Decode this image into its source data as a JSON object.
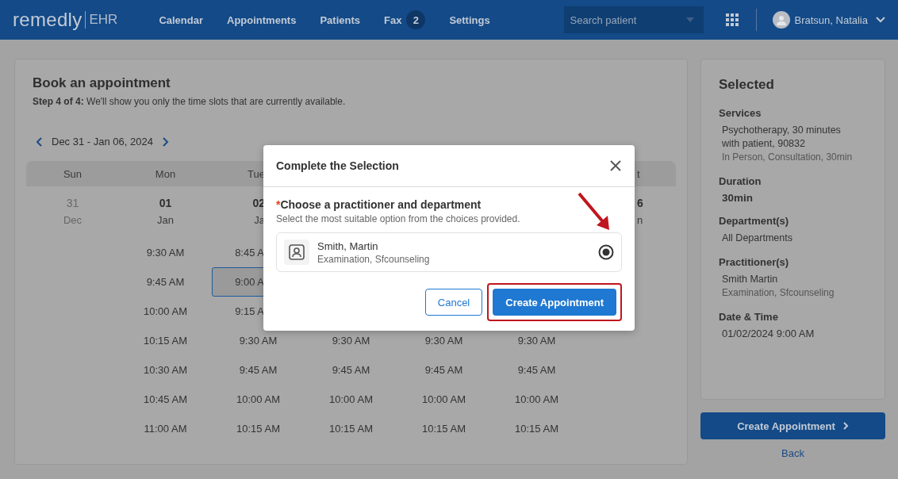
{
  "nav": {
    "logo": "remedly",
    "logo_suffix": "EHR",
    "items": [
      {
        "label": "Calendar"
      },
      {
        "label": "Appointments"
      },
      {
        "label": "Patients"
      },
      {
        "label": "Fax",
        "badge": "2"
      },
      {
        "label": "Settings"
      }
    ],
    "search": {
      "placeholder": "Search patient"
    },
    "user": "Bratsun, Natalia"
  },
  "booking": {
    "title": "Book an appointment",
    "step": "**Step 4 of 4:** We'll show you only the time slots that are currently available.",
    "range": "Dec 31 - Jan 06, 2024",
    "days": [
      {
        "kind": "whole",
        "day": "Sun",
        "date": "31",
        "month": "Dec",
        "muted": true
      },
      {
        "kind": "whole",
        "day": "Mon",
        "date": "01",
        "month": "Jan",
        "muted": false,
        "slots": [
          {
            "kind": "whole",
            "time": "9:30 AM",
            "selected": false
          },
          {
            "kind": "whole",
            "time": "9:45 AM",
            "selected": false
          },
          {
            "kind": "whole",
            "time": "10:00 AM",
            "selected": false
          },
          {
            "kind": "whole",
            "time": "10:15 AM",
            "selected": false
          },
          {
            "kind": "whole",
            "time": "10:30 AM",
            "selected": false
          },
          {
            "kind": "whole",
            "time": "10:45 AM",
            "selected": false
          },
          {
            "kind": "whole",
            "time": "11:00 AM",
            "selected": false
          }
        ]
      },
      {
        "kind": "cutright",
        "day": "Tue",
        "date": "02",
        "month": "Ja",
        "muted": false,
        "slots": [
          {
            "kind": "cut",
            "time": "8:45 A",
            "selected": false
          },
          {
            "kind": "cut",
            "time": "9:00 A",
            "selected": true
          },
          {
            "kind": "cut",
            "time": "9:15 A",
            "selected": false
          },
          {
            "kind": "whole",
            "time": "9:30 AM",
            "selected": false
          },
          {
            "kind": "whole",
            "time": "9:45 AM",
            "selected": false
          },
          {
            "kind": "whole",
            "time": "10:00 AM",
            "selected": false
          },
          {
            "kind": "whole",
            "time": "10:15 AM",
            "selected": false
          }
        ]
      },
      {
        "kind": "whole",
        "slots": [
          {
            "kind": "whole",
            "time": "9:30 AM",
            "selected": false
          },
          {
            "kind": "whole",
            "time": "9:45 AM",
            "selected": false
          },
          {
            "kind": "whole",
            "time": "10:00 AM",
            "selected": false
          },
          {
            "kind": "whole",
            "time": "10:15 AM",
            "selected": false
          }
        ]
      },
      {
        "kind": "whole",
        "slots": [
          {
            "kind": "whole",
            "time": "9:30 AM",
            "selected": false
          },
          {
            "kind": "whole",
            "time": "9:45 AM",
            "selected": false
          },
          {
            "kind": "whole",
            "time": "10:00 AM",
            "selected": false
          },
          {
            "kind": "whole",
            "time": "10:15 AM",
            "selected": false
          }
        ]
      },
      {
        "kind": "whole",
        "slots": [
          {
            "kind": "whole",
            "time": "9:30 AM",
            "selected": false
          },
          {
            "kind": "whole",
            "time": "9:45 AM",
            "selected": false
          },
          {
            "kind": "whole",
            "time": "10:00 AM",
            "selected": false
          },
          {
            "kind": "whole",
            "time": "10:15 AM",
            "selected": false
          }
        ]
      },
      {
        "kind": "cutleft",
        "day": "t",
        "date": "6",
        "month": "n",
        "muted": false
      }
    ]
  },
  "selected_panel": {
    "title": "Selected",
    "sections": [
      {
        "label": "Services",
        "lines": [
          {
            "text": "Psychotherapy, 30 minutes with patient, 90832",
            "kind": "primary"
          },
          {
            "text": "In Person, Consultation, 30min",
            "kind": "secondary"
          }
        ]
      },
      {
        "label": "Duration",
        "lines": [
          {
            "text": "30min",
            "kind": "strong"
          }
        ]
      },
      {
        "label": "Department(s)",
        "lines": [
          {
            "text": "All Departments",
            "kind": "primary"
          }
        ]
      },
      {
        "label": "Practitioner(s)",
        "lines": [
          {
            "text": "Smith Martin",
            "kind": "primary"
          },
          {
            "text": "Examination, Sfcounseling",
            "kind": "secondary"
          }
        ]
      },
      {
        "label": "Date & Time",
        "lines": [
          {
            "text": "01/02/2024 9:00 AM",
            "kind": "large"
          }
        ]
      }
    ],
    "button": "Create Appointment",
    "back": "Back"
  },
  "modal": {
    "title": "Complete the Selection",
    "required_mark": "*",
    "prompt": "Choose a practitioner and department",
    "hint": "Select the most suitable option from the choices provided.",
    "options": [
      {
        "name": "Smith, Martin",
        "detail": "Examination, Sfcounseling",
        "selected": true
      }
    ],
    "cancel": "Cancel",
    "confirm": "Create Appointment"
  }
}
